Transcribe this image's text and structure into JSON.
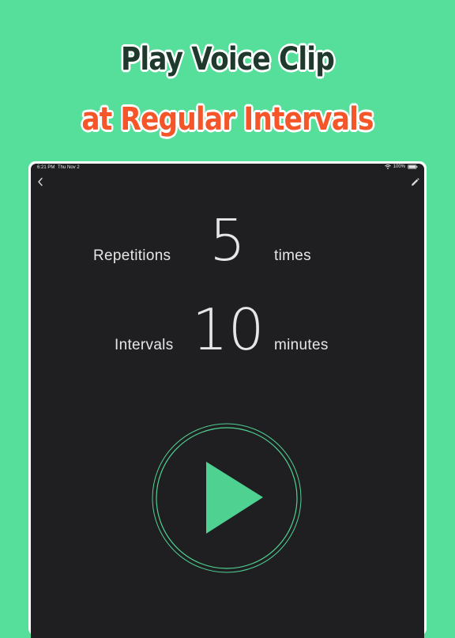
{
  "headline": {
    "line1": "Play Voice Clip",
    "line2": "at Regular Intervals"
  },
  "status_bar": {
    "time": "6:21 PM",
    "date": "Thu Nov 2",
    "battery": "100%"
  },
  "settings": {
    "repetitions": {
      "label": "Repetitions",
      "value": "5",
      "unit": "times"
    },
    "intervals": {
      "label": "Intervals",
      "value": "10",
      "unit": "minutes"
    }
  },
  "icons": {
    "back": "chevron-left-icon",
    "edit": "pencil-icon",
    "play": "play-icon",
    "wifi": "wifi-icon",
    "battery": "battery-icon"
  },
  "colors": {
    "background": "#56DE9B",
    "headline_dark": "#1f3a2c",
    "headline_accent": "#F4562A",
    "screen": "#1F1F21",
    "accent": "#4FD192",
    "text": "#E6E6E6"
  }
}
